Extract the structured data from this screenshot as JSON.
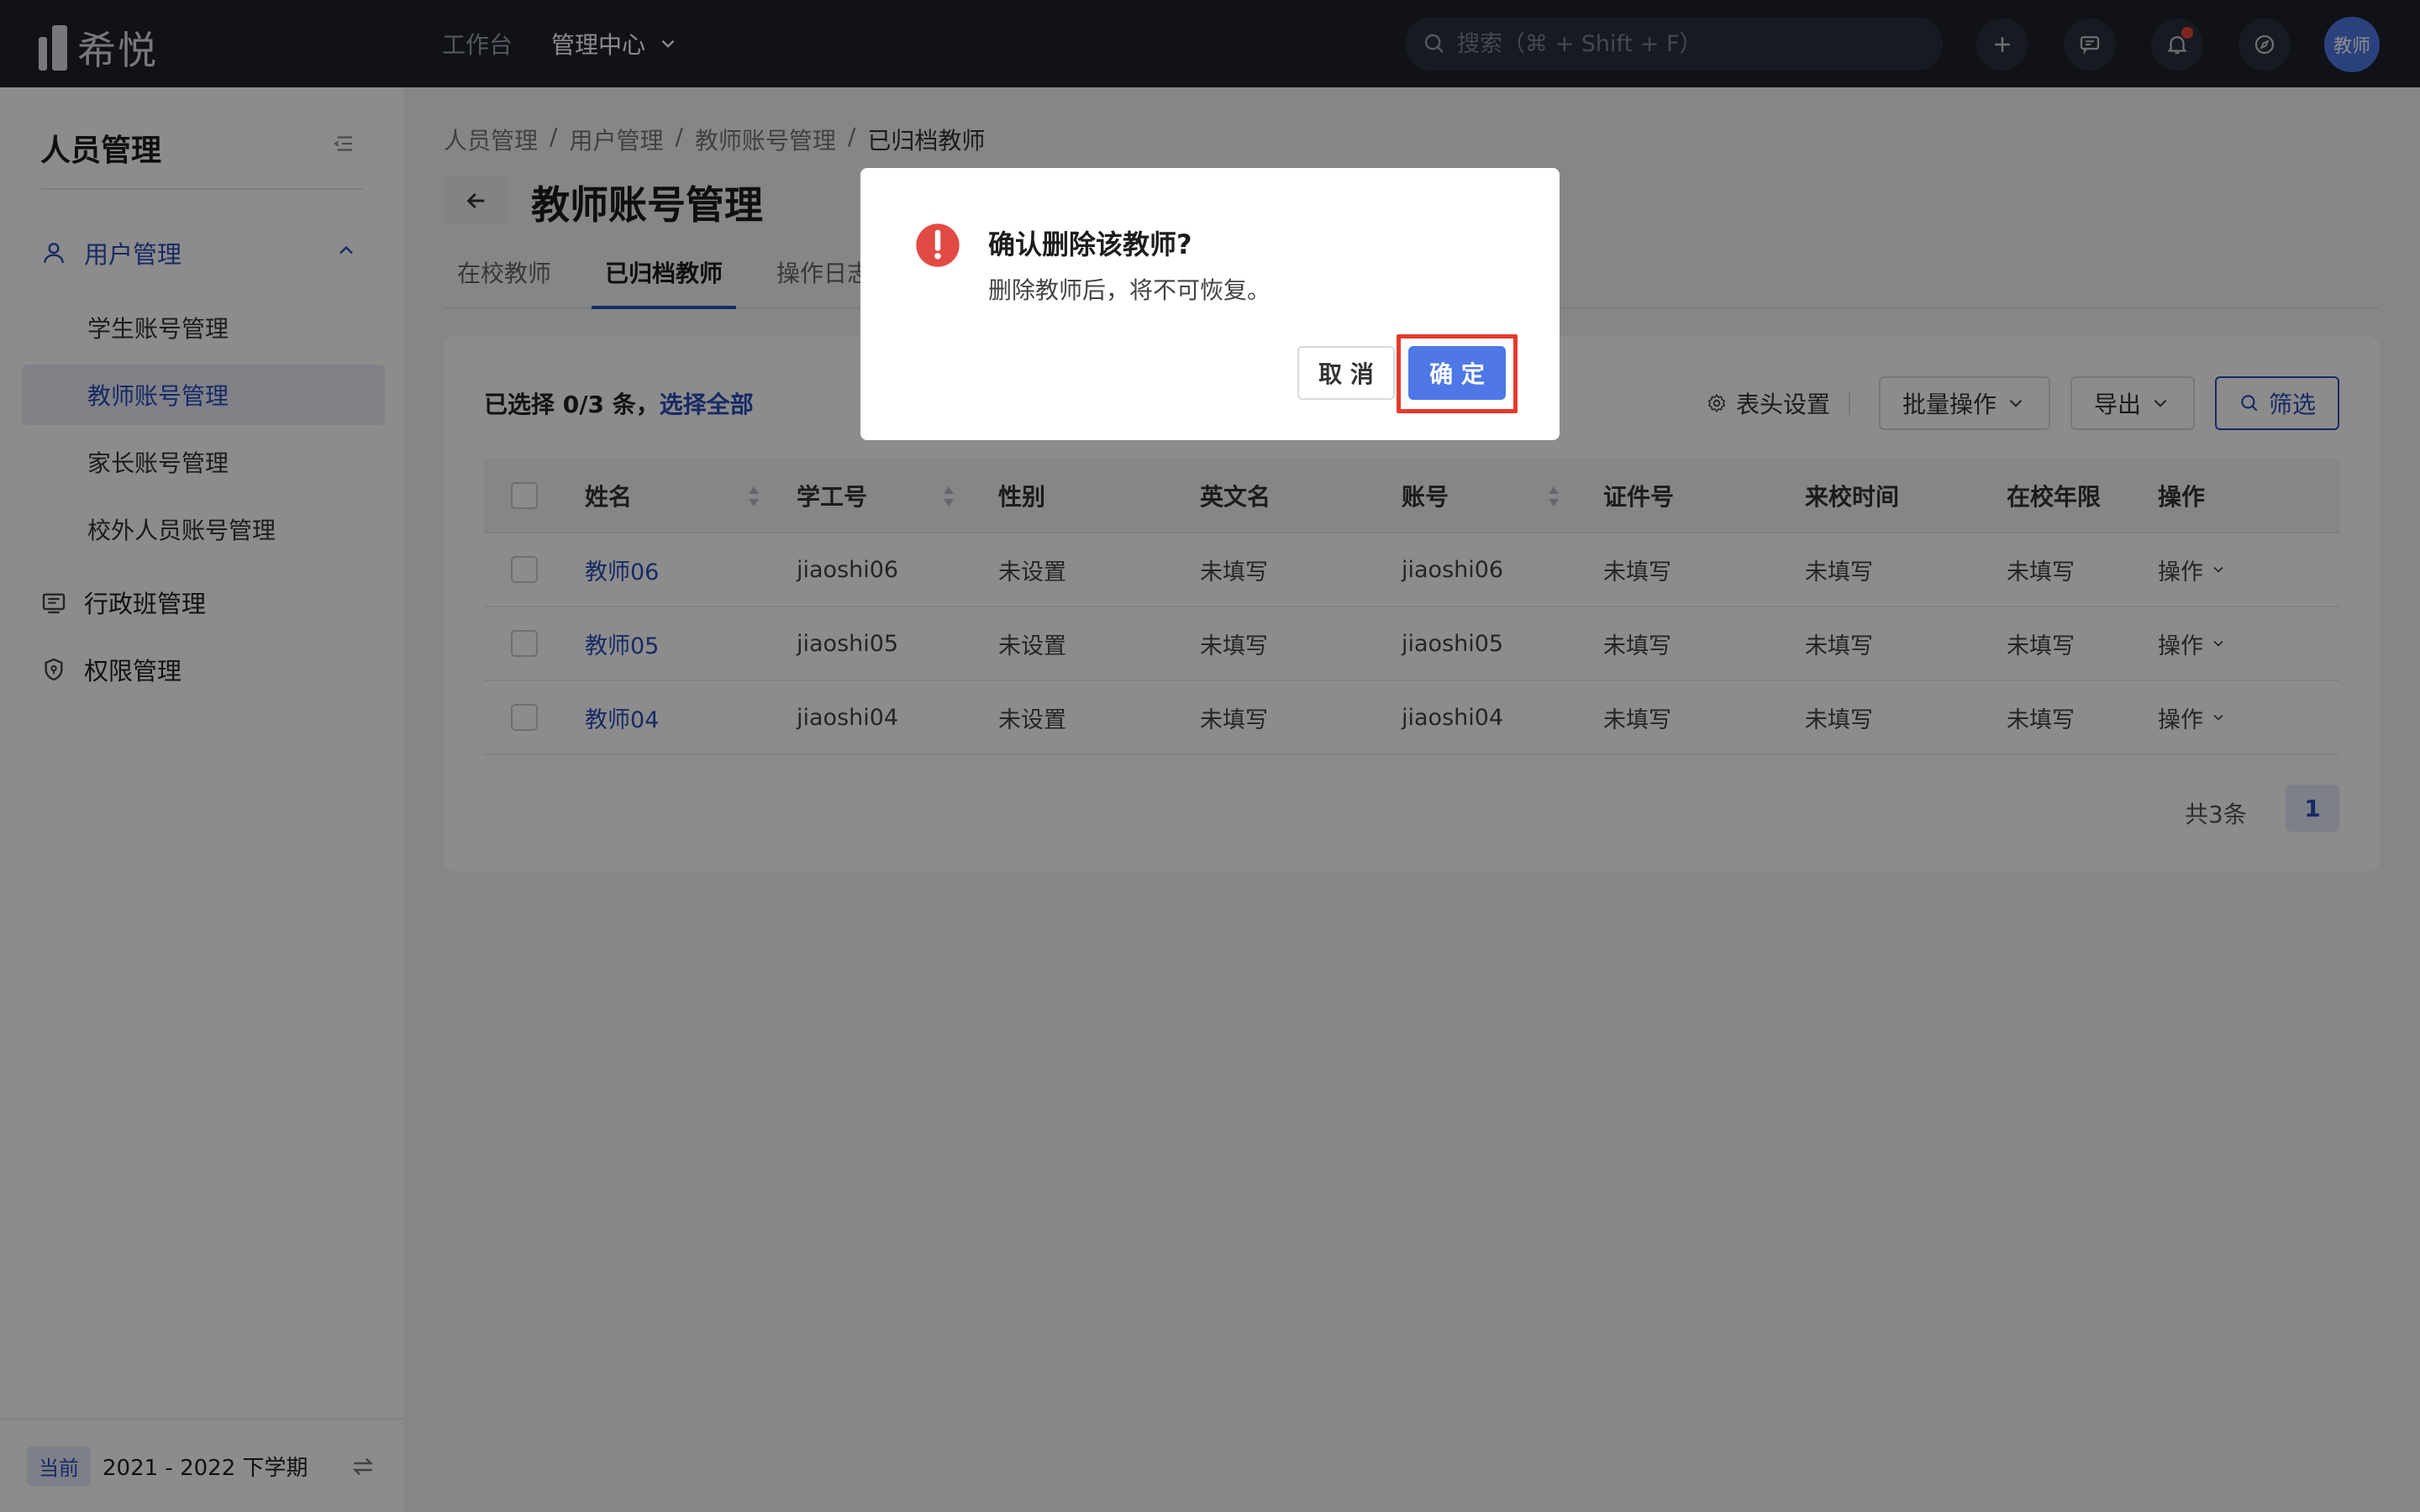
{
  "app": {
    "logo_text": "希悦",
    "nav": [
      {
        "label": "工作台"
      },
      {
        "label": "管理中心"
      }
    ],
    "search_placeholder": "搜索（⌘ + Shift + F）",
    "avatar_label": "教师"
  },
  "sidebar": {
    "title": "人员管理",
    "group_user": "用户管理",
    "sub_items": [
      "学生账号管理",
      "教师账号管理",
      "家长账号管理",
      "校外人员账号管理"
    ],
    "group_class": "行政班管理",
    "group_permission": "权限管理",
    "term_tag": "当前",
    "term_text": "2021 - 2022 下学期"
  },
  "main": {
    "breadcrumb": [
      "人员管理",
      "用户管理",
      "教师账号管理",
      "已归档教师"
    ],
    "breadcrumb_sep": "/",
    "page_title": "教师账号管理",
    "tabs": [
      "在校教师",
      "已归档教师",
      "操作日志"
    ],
    "selection": {
      "text": "已选择 0/3 条，",
      "select_all": "选择全部"
    },
    "toolbar": {
      "header_settings": "表头设置",
      "batch": "批量操作",
      "export": "导出",
      "filter": "筛选"
    },
    "table": {
      "columns": [
        "姓名",
        "学工号",
        "性别",
        "英文名",
        "账号",
        "证件号",
        "来校时间",
        "在校年限",
        "操作"
      ],
      "rows": [
        {
          "name": "教师06",
          "id": "jiaoshi06",
          "gender": "未设置",
          "en": "未填写",
          "account": "jiaoshi06",
          "cert": "未填写",
          "join": "未填写",
          "years": "未填写",
          "op": "操作"
        },
        {
          "name": "教师05",
          "id": "jiaoshi05",
          "gender": "未设置",
          "en": "未填写",
          "account": "jiaoshi05",
          "cert": "未填写",
          "join": "未填写",
          "years": "未填写",
          "op": "操作"
        },
        {
          "name": "教师04",
          "id": "jiaoshi04",
          "gender": "未设置",
          "en": "未填写",
          "account": "jiaoshi04",
          "cert": "未填写",
          "join": "未填写",
          "years": "未填写",
          "op": "操作"
        }
      ]
    },
    "pagination": {
      "total": "共3条",
      "page": "1"
    }
  },
  "modal": {
    "title": "确认删除该教师?",
    "description": "删除教师后，将不可恢复。",
    "cancel": "取 消",
    "ok": "确 定"
  },
  "colors": {
    "accent": "#2b4db8",
    "primary_button": "#4f77e6",
    "warning": "#e24b44",
    "highlight_box": "#e53a2b",
    "topbar": "#1e222c"
  },
  "icons": [
    "search-icon",
    "plus-icon",
    "chat-icon",
    "bell-icon",
    "compass-icon",
    "collapse-icon",
    "user-icon",
    "chevron-up-icon",
    "class-icon",
    "shield-icon",
    "swap-icon",
    "back-arrow-icon",
    "gear-icon",
    "chevron-down-icon",
    "sort-icon",
    "warning-icon"
  ]
}
